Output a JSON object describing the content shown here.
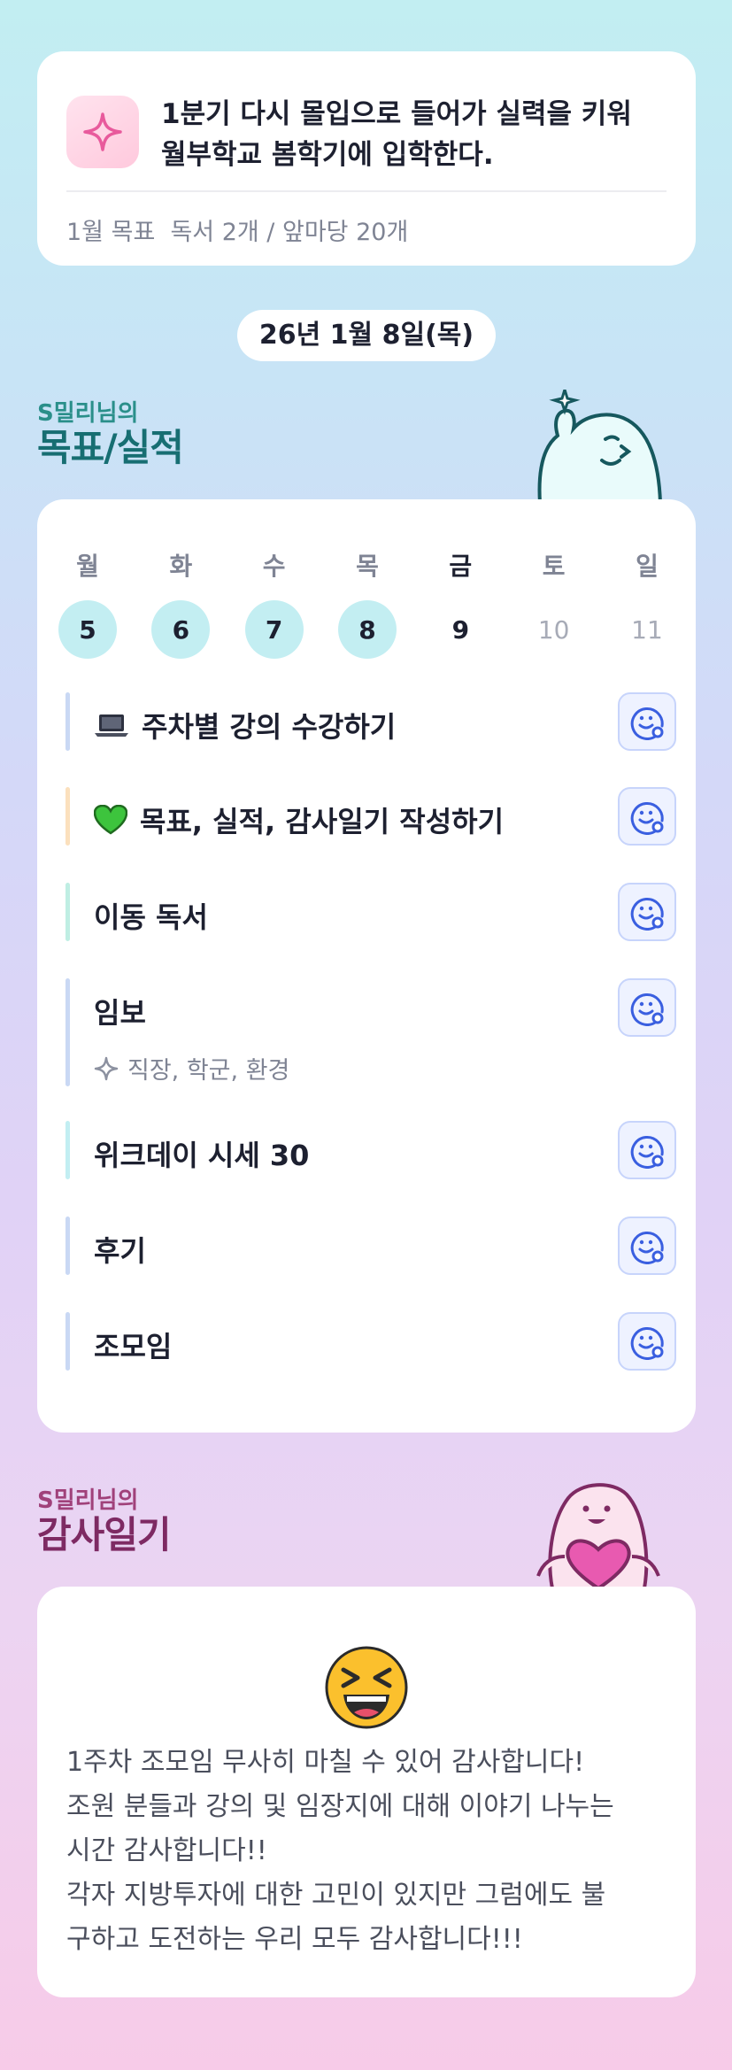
{
  "goal": {
    "text_line1": "1분기 다시 몰입으로 들어가 실력을 키워",
    "text_line2": "월부학교 봄학기에 입학한다.",
    "monthly": "1월 목표  독서 2개 / 앞마당 20개"
  },
  "date": "26년 1월 8일(목)",
  "goal_section": {
    "small": "S밀리님의",
    "big": "목표/실적"
  },
  "week": [
    {
      "name": "월",
      "num": "5",
      "state": "done"
    },
    {
      "name": "화",
      "num": "6",
      "state": "done"
    },
    {
      "name": "수",
      "num": "7",
      "state": "done"
    },
    {
      "name": "목",
      "num": "8",
      "state": "done"
    },
    {
      "name": "금",
      "num": "9",
      "state": "today"
    },
    {
      "name": "토",
      "num": "10",
      "state": "weekend"
    },
    {
      "name": "일",
      "num": "11",
      "state": "weekend"
    }
  ],
  "tasks": [
    {
      "label": "주차별 강의 수강하기",
      "icon": "laptop-icon",
      "bar_color": "#c9d8f4"
    },
    {
      "label": "목표, 실적, 감사일기 작성하기",
      "icon": "green-heart-icon",
      "bar_color": "#fbe0bd"
    },
    {
      "label": "이동 독서",
      "bar_color": "#bfeee3"
    },
    {
      "label": "임보",
      "sub": "직장, 학군, 환경",
      "bar_color": "#c9d8f4"
    },
    {
      "label": "위크데이 시세 30",
      "bar_color": "#c2eef2"
    },
    {
      "label": "후기",
      "bar_color": "#c9d8f4"
    },
    {
      "label": "조모임",
      "bar_color": "#c9d8f4"
    }
  ],
  "thanks_section": {
    "small": "S밀리님의",
    "big": "감사일기"
  },
  "thanks": {
    "emoji": "laughing-face-emoji",
    "text": "1주차 조모임 무사히 마칠 수 있어 감사합니다!\n조원 분들과 강의 및 임장지에 대해 이야기 나누는\n시간 감사합니다!!\n각자 지방투자에 대한 고민이 있지만 그럼에도 불\n구하고 도전하는 우리 모두 감사합니다!!!"
  },
  "colors": {
    "accent_teal": "#176e72",
    "accent_plum": "#7e2a63",
    "done_circle": "#c3eef2",
    "face_button": "#eef2ff"
  }
}
